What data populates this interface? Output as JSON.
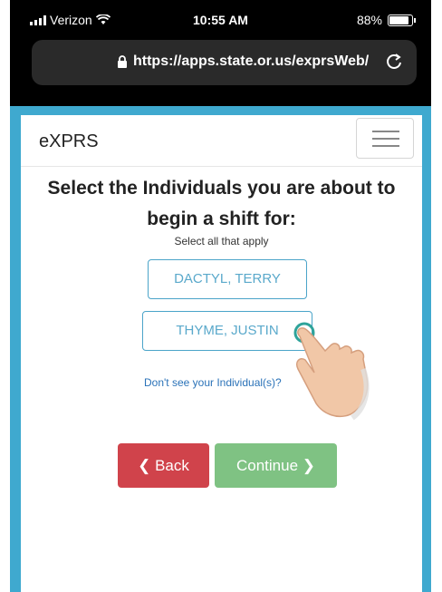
{
  "status": {
    "carrier": "Verizon",
    "time": "10:55 AM",
    "battery": "88%"
  },
  "browser": {
    "url": "https://apps.state.or.us/exprsWeb/"
  },
  "app": {
    "brand": "eXPRS",
    "headline_line1": "Select the Individuals you are about to",
    "headline_line2": "begin a shift for:",
    "subheading": "Select all that apply",
    "individuals": [
      "DACTYL, TERRY",
      "THYME, JUSTIN"
    ],
    "missing_link": "Don't see your Individual(s)?",
    "back_label": "Back",
    "continue_label": "Continue"
  },
  "colors": {
    "frame": "#3fa9cf",
    "back": "#d0434b",
    "continue": "#7fc283",
    "outline": "#4ba4c9"
  }
}
